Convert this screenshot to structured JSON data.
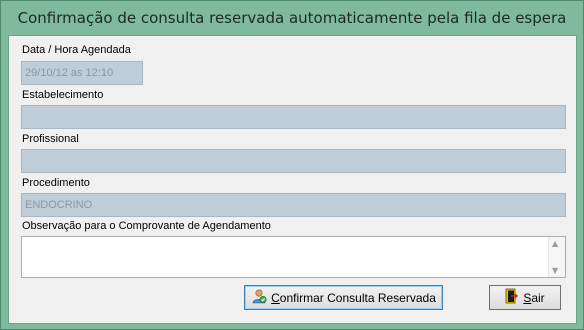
{
  "window": {
    "title": "Confirmação de consulta reservada automaticamente pela fila de espera"
  },
  "form": {
    "data_hora": {
      "label": "Data / Hora Agendada",
      "value": "29/10/12 as 12:10"
    },
    "estabelecimento": {
      "label": "Estabelecimento",
      "value": ""
    },
    "profissional": {
      "label": "Profissional",
      "value": ""
    },
    "procedimento": {
      "label": "Procedimento",
      "value": "ENDOCRINO"
    },
    "observacao": {
      "label": "Observação para o Comprovante de Agendamento",
      "value": ""
    }
  },
  "buttons": {
    "confirmar": {
      "mnemonic": "C",
      "rest": "onfirmar Consulta Reservada",
      "icon": "user-check-icon"
    },
    "sair": {
      "mnemonic": "S",
      "rest": "air",
      "icon": "exit-door-icon"
    }
  },
  "colors": {
    "frame": "#80ba9c",
    "disabled_field": "#bfcdd9",
    "client_bg": "#f0f0f0"
  }
}
